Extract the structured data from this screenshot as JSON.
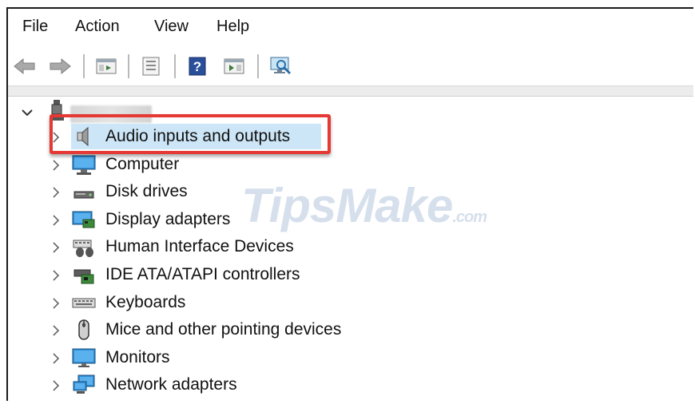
{
  "menu": {
    "file": "File",
    "action": "Action",
    "view": "View",
    "help": "Help"
  },
  "toolbar": {
    "buttons": [
      "back-arrow-icon",
      "forward-arrow-icon",
      "show-hide-console-tree-icon",
      "properties-icon",
      "help-icon",
      "show-action-pane-icon",
      "scan-hardware-changes-icon"
    ]
  },
  "tree": {
    "items": [
      {
        "label": "Audio inputs and outputs",
        "icon": "speaker-icon",
        "selected": true
      },
      {
        "label": "Computer",
        "icon": "computer-icon"
      },
      {
        "label": "Disk drives",
        "icon": "disk-drive-icon"
      },
      {
        "label": "Display adapters",
        "icon": "display-adapter-icon"
      },
      {
        "label": "Human Interface Devices",
        "icon": "hid-icon"
      },
      {
        "label": "IDE ATA/ATAPI controllers",
        "icon": "ide-controller-icon"
      },
      {
        "label": "Keyboards",
        "icon": "keyboard-icon"
      },
      {
        "label": "Mice and other pointing devices",
        "icon": "mouse-icon"
      },
      {
        "label": "Monitors",
        "icon": "monitor-icon"
      },
      {
        "label": "Network adapters",
        "icon": "network-adapter-icon"
      }
    ]
  },
  "watermark": {
    "main": "TipsMake",
    "suffix": ".com"
  },
  "colors": {
    "highlight": "#e53935",
    "selection": "#cde6f7"
  }
}
